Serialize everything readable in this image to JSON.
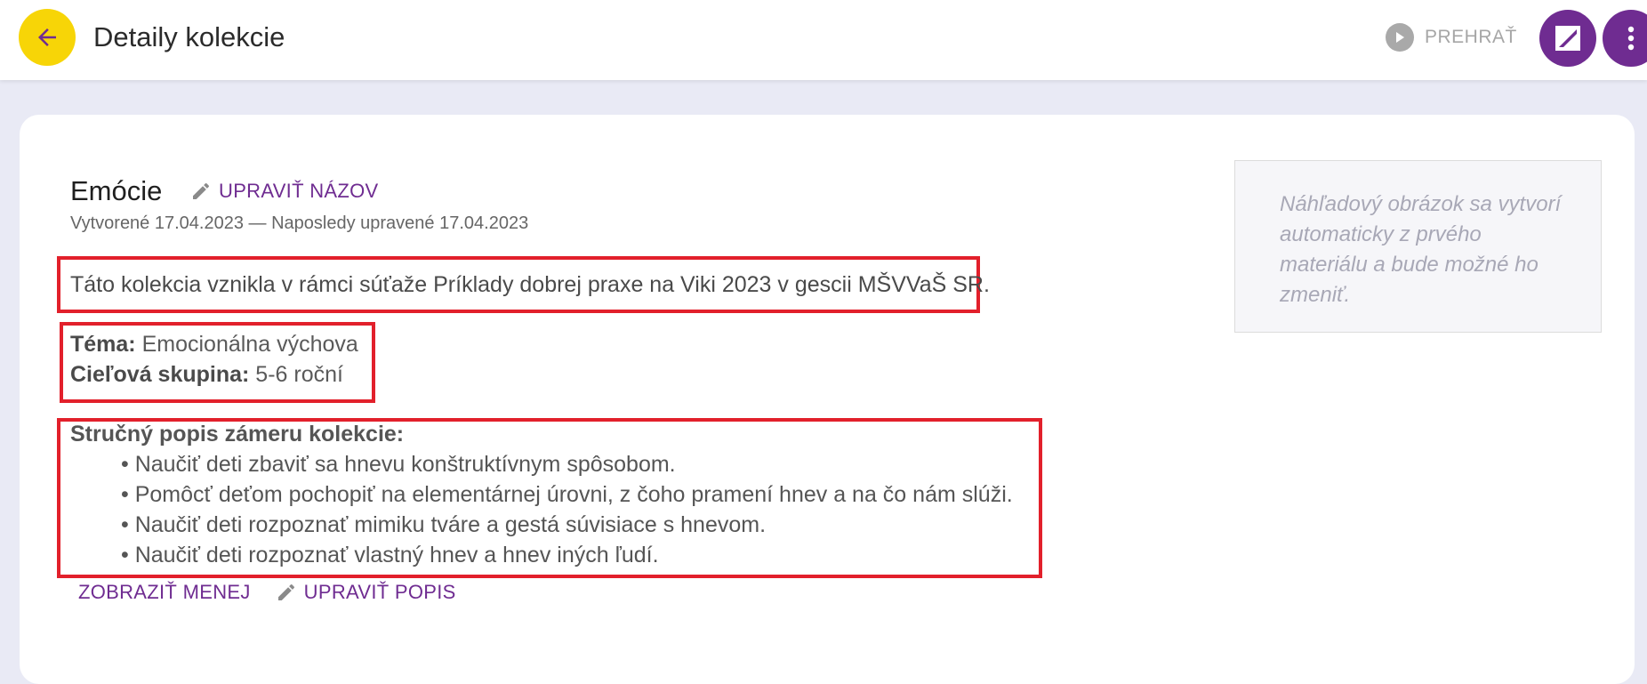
{
  "header": {
    "title": "Detaily kolekcie",
    "play_label": "PREHRAŤ"
  },
  "collection": {
    "name": "Emócie",
    "edit_name_label": "UPRAVIŤ NÁZOV",
    "meta": "Vytvorené 17.04.2023 — Naposledy upravené 17.04.2023",
    "description": "Táto kolekcia vznikla v rámci súťaže Príklady dobrej praxe na Viki 2023 v gescii MŠVVaŠ SR.",
    "topic_label": "Téma:",
    "topic_value": " Emocionálna výchova",
    "target_label": "Cieľová skupina:",
    "target_value": " 5-6 roční",
    "aim_title": "Stručný popis zámeru kolekcie:",
    "aims": [
      "• Naučiť deti zbaviť sa hnevu konštruktívnym spôsobom.",
      "• Pomôcť deťom pochopiť na elementárnej úrovni, z čoho pramení hnev a na čo nám slúži.",
      "• Naučiť deti rozpoznať mimiku tváre a gestá súvisiace s hnevom.",
      "• Naučiť deti rozpoznať vlastný hnev a hnev iných ľudí."
    ],
    "show_less_label": "ZOBRAZIŤ MENEJ",
    "edit_desc_label": "UPRAVIŤ POPIS"
  },
  "thumbnail": {
    "text": "Náhľadový obrázok sa vytvorí automaticky z prvého materiálu a bude možné ho zmeniť."
  },
  "colors": {
    "accent": "#6f2c91",
    "back_button": "#f7d507",
    "highlight": "#e2202b"
  },
  "icons": [
    "arrow-left-icon",
    "play-icon",
    "board-icon",
    "more-vertical-icon",
    "pencil-icon"
  ]
}
